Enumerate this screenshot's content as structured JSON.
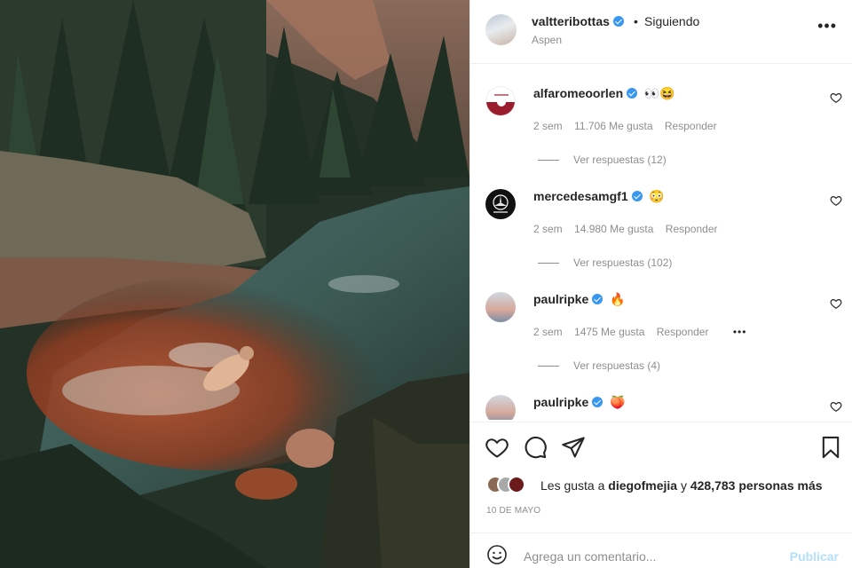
{
  "post": {
    "username": "valtteribottas",
    "separator": "•",
    "follow_status": "Siguiendo",
    "location": "Aspen"
  },
  "comments": [
    {
      "username": "alfaromeoorlen",
      "emoji": "👀😆",
      "time": "2 sem",
      "likes": "11.706 Me gusta",
      "reply": "Responder",
      "view_replies": "Ver respuestas (12)",
      "show_more": false
    },
    {
      "username": "mercedesamgf1",
      "emoji": "😳",
      "time": "2 sem",
      "likes": "14.980 Me gusta",
      "reply": "Responder",
      "view_replies": "Ver respuestas (102)",
      "show_more": false
    },
    {
      "username": "paulripke",
      "emoji": "🔥",
      "time": "2 sem",
      "likes": "1475 Me gusta",
      "reply": "Responder",
      "view_replies": "Ver respuestas (4)",
      "show_more": true
    },
    {
      "username": "paulripke",
      "emoji": "🍑",
      "time": "",
      "likes": "",
      "reply": "",
      "view_replies": "",
      "show_more": false
    }
  ],
  "likes": {
    "prefix": "Les gusta a",
    "user": "diegofmejia",
    "conj": "y",
    "count": "428,783 personas más"
  },
  "date": "10 DE MAYO",
  "comment_box": {
    "placeholder": "Agrega un comentario...",
    "publish": "Publicar"
  },
  "colors": {
    "verified": "#3897f0",
    "publish_disabled": "#b2dffc",
    "muted": "#8e8e8e"
  },
  "icons": [
    "heart-icon",
    "comment-icon",
    "share-icon",
    "bookmark-icon",
    "emoji-icon",
    "more-options-icon",
    "verified-badge-icon"
  ]
}
